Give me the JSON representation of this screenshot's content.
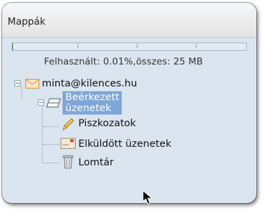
{
  "panel": {
    "title": "Mappák"
  },
  "quota": {
    "text": "Felhasznált: 0.01%,összes: 25 MB",
    "used_percent": 0.01
  },
  "tree": {
    "account": {
      "label": "minta@kilences.hu",
      "icon": "envelope-icon",
      "expanded": true
    },
    "inbox": {
      "label": "Beérkezett üzenetek",
      "icon": "inbox-tray-icon",
      "expanded": true,
      "selected": true
    },
    "children": [
      {
        "label": "Piszkozatok",
        "icon": "pencil-icon"
      },
      {
        "label": "Elküldött üzenetek",
        "icon": "sent-mail-icon"
      },
      {
        "label": "Lomtár",
        "icon": "trash-can-icon"
      }
    ]
  },
  "colors": {
    "panel_bg": "#dbe5ef",
    "selection": "#7fa6d6"
  }
}
